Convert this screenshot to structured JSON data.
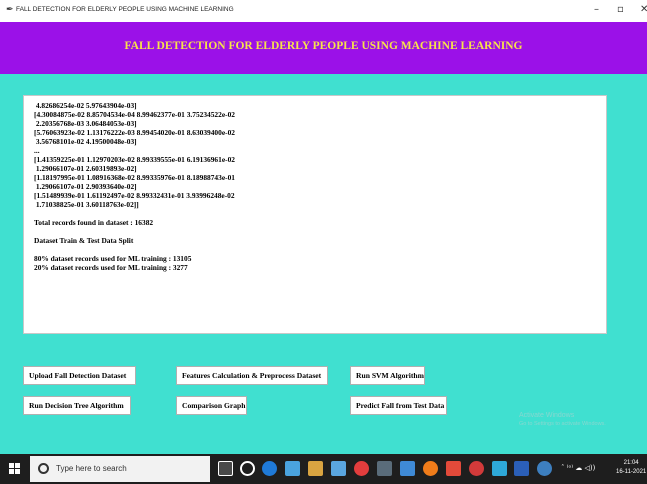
{
  "window": {
    "title": "FALL DETECTION FOR ELDERLY PEOPLE USING MACHINE LEARNING",
    "app_icon": "feather-icon",
    "minimize": "–",
    "maximize": "▫",
    "close": "✕"
  },
  "header": {
    "title": "FALL DETECTION FOR ELDERLY PEOPLE USING MACHINE LEARNING",
    "background": "#9b11e8",
    "color": "#f7e24a"
  },
  "output": {
    "lines": [
      " 4.82686254e-02 5.97643904e-03]",
      "[4.30084875e-02 8.85704534e-04 8.99462377e-01 3.75234522e-02",
      " 2.20356768e-03 3.06484053e-03]",
      "[5.76063923e-02 1.13176222e-03 8.99454020e-01 8.63039400e-02",
      " 3.56768101e-02 4.19500048e-03]",
      "...",
      "[1.41359225e-01 1.12970203e-02 8.99339555e-01 6.19136961e-02",
      " 1.29066107e-01 2.60319893e-02]",
      "[1.18197995e-01 1.08916368e-02 8.99335976e-01 8.18988743e-01",
      " 1.29066107e-01 2.90393640e-02]",
      "[1.51489939e-01 1.61192497e-02 8.99332431e-01 3.93996248e-02",
      " 1.71038825e-01 3.60118763e-02]]",
      "",
      "Total records found in dataset : 16382",
      "",
      "Dataset Train & Test Data Split",
      "",
      "80% dataset records used for ML training : 13105",
      "20% dataset records used for ML training : 3277"
    ]
  },
  "buttons": {
    "upload": "Upload Fall Detection Dataset",
    "features": "Features Calculation & Preprocess Dataset",
    "svm": "Run SVM Algorithm",
    "decision_tree": "Run Decision Tree Algorithm",
    "comparison": "Comparison Graph",
    "predict": "Predict Fall from Test Data"
  },
  "watermark": {
    "line1": "Activate Windows",
    "line2": "Go to Settings to activate Windows."
  },
  "taskbar": {
    "search_placeholder": "Type here to search",
    "tray": "ˆ  ⁽ᵒ⁾  ☁  ◁))",
    "time": "21:04",
    "date": "16-11-2021",
    "colors": {
      "background": "#1e1e1e",
      "page_background": "#40e0d0"
    }
  }
}
